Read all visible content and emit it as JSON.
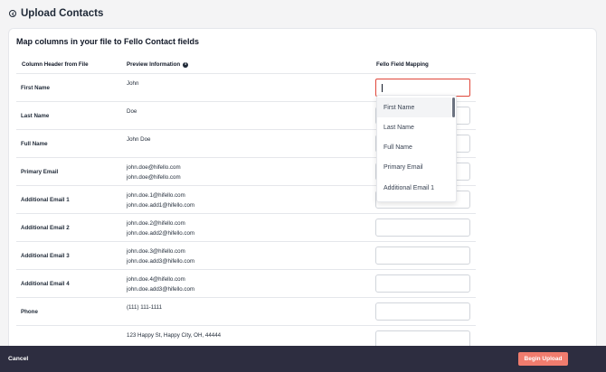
{
  "header": {
    "title": "Upload Contacts"
  },
  "card": {
    "title": "Map columns in your file to Fello Contact fields",
    "columns": {
      "header": "Column Header from File",
      "preview": "Preview Information",
      "mapping": "Fello Field Mapping"
    },
    "rows": [
      {
        "label": "First Name",
        "preview": [
          "John"
        ]
      },
      {
        "label": "Last Name",
        "preview": [
          "Doe"
        ]
      },
      {
        "label": "Full Name",
        "preview": [
          "John Doe"
        ]
      },
      {
        "label": "Primary Email",
        "preview": [
          "john.doe@hifello.com",
          "john.doe@hifello.com"
        ]
      },
      {
        "label": "Additional Email 1",
        "preview": [
          "john.doe.1@hifello.com",
          "john.doe.add1@hifello.com"
        ]
      },
      {
        "label": "Additional Email 2",
        "preview": [
          "john.doe.2@hifello.com",
          "john.doe.add2@hifello.com"
        ]
      },
      {
        "label": "Additional Email 3",
        "preview": [
          "john.doe.3@hifello.com",
          "john.doe.add3@hifello.com"
        ]
      },
      {
        "label": "Additional Email 4",
        "preview": [
          "john.doe.4@hifello.com",
          "john.doe.add3@hifello.com"
        ]
      },
      {
        "label": "Phone",
        "preview": [
          "(111) 111-1111"
        ]
      },
      {
        "label": "",
        "preview": [
          "123 Happy St, Happy City, OH, 44444"
        ]
      }
    ]
  },
  "dropdown": {
    "options": [
      "First Name",
      "Last Name",
      "Full Name",
      "Primary Email",
      "Additional Email 1"
    ],
    "highlighted": "First Name"
  },
  "footer": {
    "cancel_label": "Cancel",
    "upload_label": "Begin Upload"
  },
  "colors": {
    "accent": "#f07c6e",
    "active_border": "#e0463a",
    "footer_bg": "#2d2d40"
  }
}
